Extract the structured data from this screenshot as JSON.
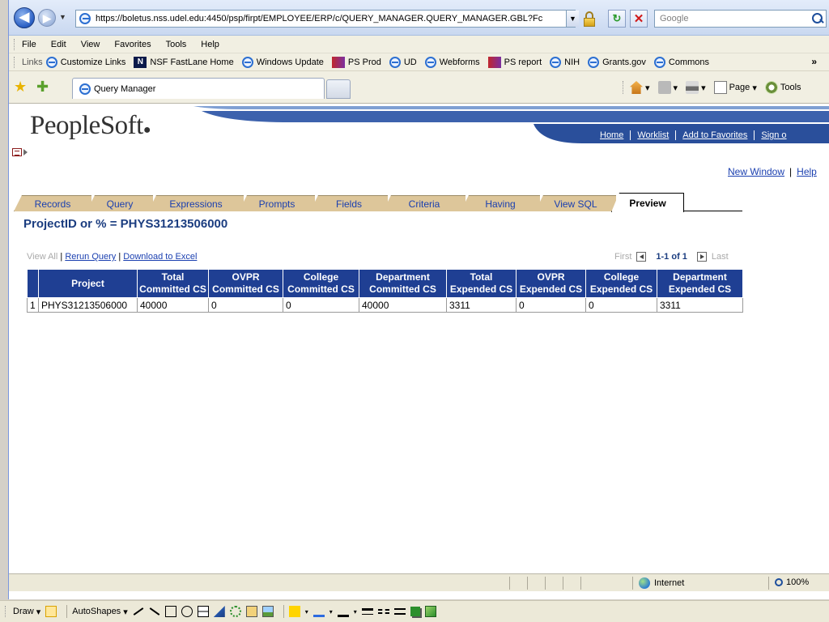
{
  "browser": {
    "url": "https://boletus.nss.udel.edu:4450/psp/firpt/EMPLOYEE/ERP/c/QUERY_MANAGER.QUERY_MANAGER.GBL?Fc",
    "search_placeholder": "Google",
    "menu": [
      "File",
      "Edit",
      "View",
      "Favorites",
      "Tools",
      "Help"
    ],
    "links_label": "Links",
    "links": [
      {
        "label": "Customize Links",
        "icon": "ie-page-icon"
      },
      {
        "label": "NSF FastLane Home",
        "icon": "nsf-icon"
      },
      {
        "label": "Windows Update",
        "icon": "ie-page-icon"
      },
      {
        "label": "PS Prod",
        "icon": "peoplesoft-icon"
      },
      {
        "label": "UD",
        "icon": "ie-page-icon"
      },
      {
        "label": "Webforms",
        "icon": "ie-page-icon"
      },
      {
        "label": "PS report",
        "icon": "peoplesoft-icon"
      },
      {
        "label": "NIH",
        "icon": "ie-page-icon"
      },
      {
        "label": "Grants.gov",
        "icon": "ie-page-icon"
      },
      {
        "label": "Commons",
        "icon": "ie-page-icon"
      }
    ],
    "more_links": "»",
    "tab_title": "Query Manager",
    "commands": {
      "page": "Page",
      "tools": "Tools"
    },
    "status": {
      "zone": "Internet",
      "zoom": "100%"
    }
  },
  "peoplesoft": {
    "logo": "PeopleSoft",
    "nav_links": [
      "Home",
      "Worklist",
      "Add to Favorites",
      "Sign o"
    ],
    "page_links": {
      "new_window": "New Window",
      "help": "Help"
    },
    "tabs": [
      "Records",
      "Query",
      "Expressions",
      "Prompts",
      "Fields",
      "Criteria",
      "Having",
      "View SQL",
      "Preview"
    ],
    "active_tab": "Preview",
    "query_title": "ProjectID or % = PHYS31213506000",
    "result_links": {
      "view_all": "View All",
      "rerun": "Rerun Query",
      "download": "Download to Excel"
    },
    "pager": {
      "first": "First",
      "count": "1-1 of 1",
      "last": "Last"
    },
    "table": {
      "headers": [
        "Project",
        "Total Committed CS",
        "OVPR Committed CS",
        "College Committed CS",
        "Department Committed CS",
        "Total Expended CS",
        "OVPR Expended CS",
        "College Expended CS",
        "Department Expended CS"
      ],
      "rows": [
        {
          "num": "1",
          "cells": [
            "PHYS31213506000",
            "40000",
            "0",
            "0",
            "40000",
            "3311",
            "0",
            "0",
            "3311"
          ]
        }
      ]
    }
  },
  "draw_toolbar": {
    "draw": "Draw",
    "autoshapes": "AutoShapes"
  },
  "colors": {
    "ps_header_blue": "#1f3f93",
    "ps_title_blue": "#1b3d80",
    "tab_tan": "#ddc69a",
    "link_blue": "#1a3fb0"
  }
}
